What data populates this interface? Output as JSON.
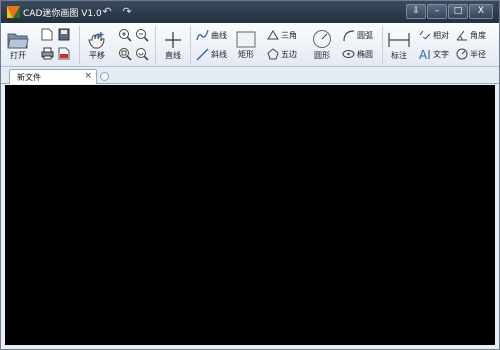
{
  "app": {
    "title": "CAD迷你画图 V1.0"
  },
  "titlebar": {
    "quick_access": [
      {
        "name": "undo",
        "icon": "undo-arrow-icon",
        "glyph": "↶"
      },
      {
        "name": "redo",
        "icon": "redo-arrow-icon",
        "glyph": "↷"
      }
    ],
    "window_controls": [
      {
        "name": "menu",
        "glyph": "⇩"
      },
      {
        "name": "minimize",
        "glyph": "–"
      },
      {
        "name": "maximize",
        "glyph": "□"
      },
      {
        "name": "close",
        "glyph": "X"
      }
    ]
  },
  "toolbar": {
    "open": "打开",
    "pan": "平移",
    "line": "直线",
    "curve": "曲线",
    "slant": "斜线",
    "rect": "矩形",
    "triangle": "三角",
    "pentagon": "五边",
    "circle": "圆形",
    "arc": "圆弧",
    "ellipse": "椭圆",
    "dimension": "标注",
    "relative": "相对",
    "angle": "角度",
    "text": "文字",
    "radius": "半径"
  },
  "tabs": {
    "active_label": "新文件",
    "close_glyph": "×"
  },
  "colors": {
    "titlebar": "#2e3b4d",
    "ribbon": "#eef2f8",
    "canvas": "#000000",
    "icon_blue": "#2f63b0",
    "logo_orange": "#e8731c"
  }
}
